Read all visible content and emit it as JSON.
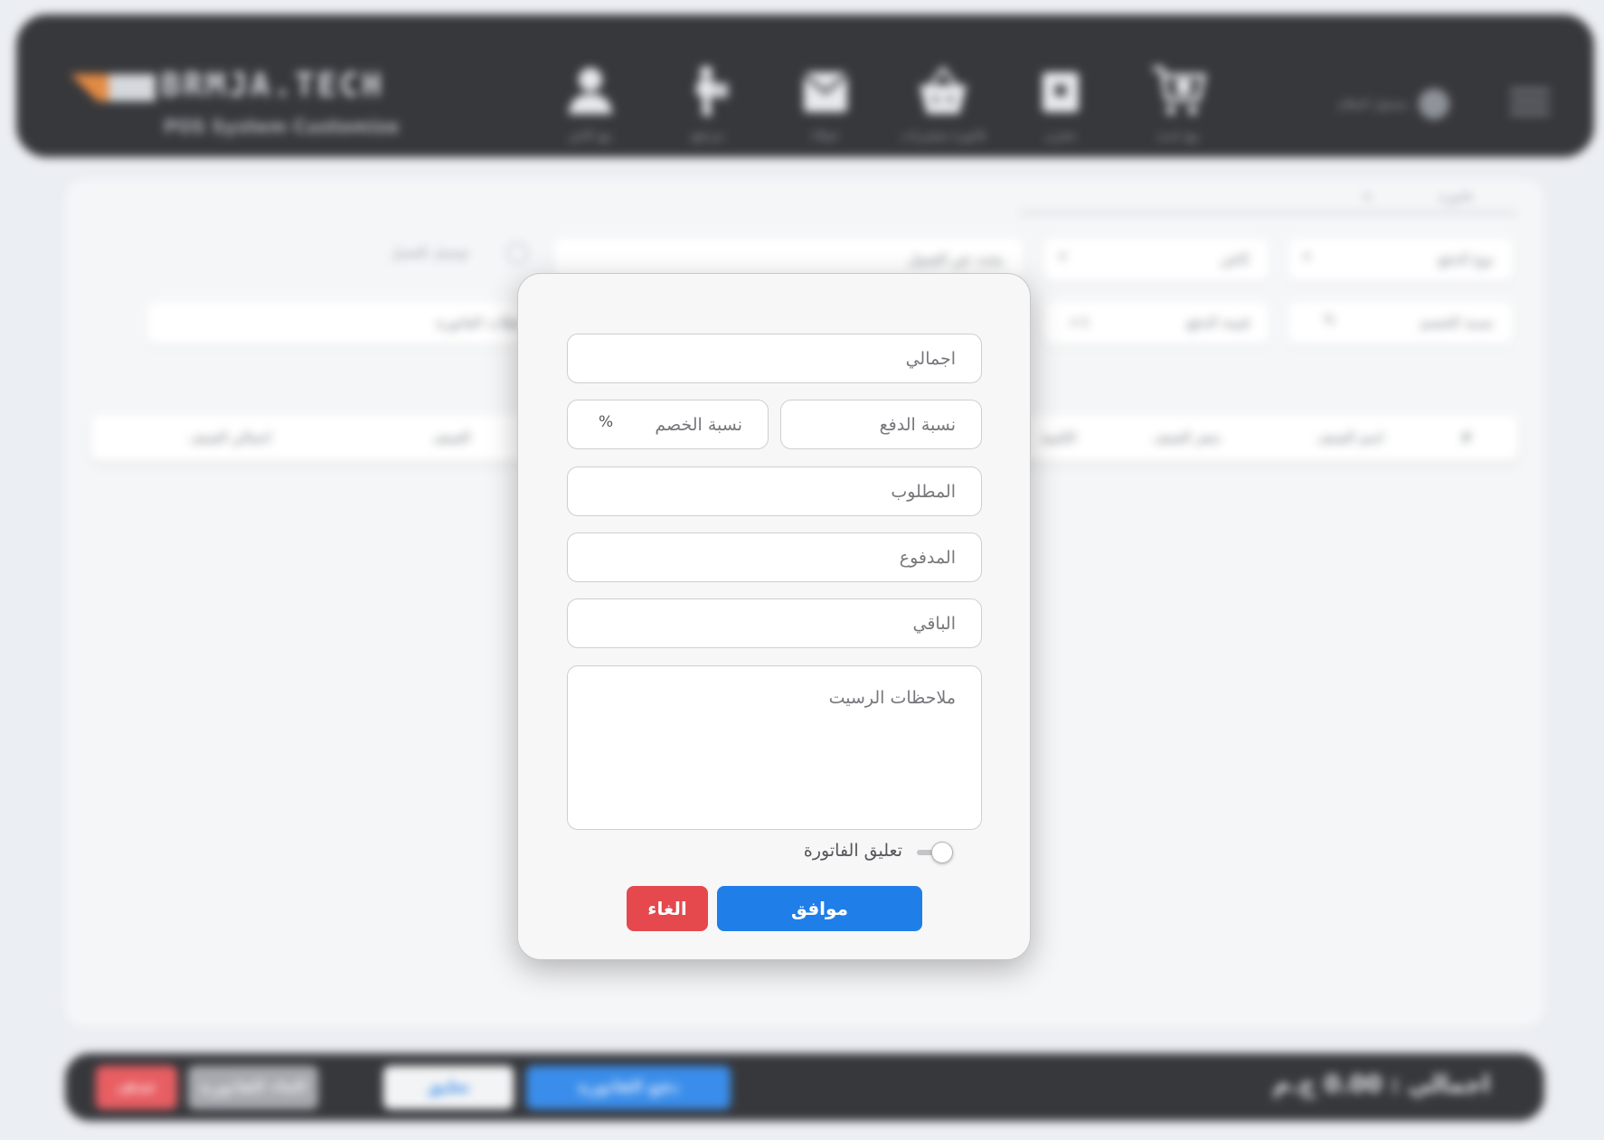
{
  "header": {
    "brand_name": "BRMJA.TECH",
    "brand_tagline": "POS System Customize",
    "nav": [
      {
        "label": "بيع جديد",
        "icon": "cart-add-icon"
      },
      {
        "label": "مخزن",
        "icon": "box-icon"
      },
      {
        "label": "فاتورة مشتريات",
        "icon": "basket-icon"
      },
      {
        "label": "عملاء",
        "icon": "mail-icon"
      },
      {
        "label": "مرتجع",
        "icon": "delivery-icon"
      },
      {
        "label": "بيع كاش",
        "icon": "user-icon"
      }
    ],
    "user_label": "مسئول النظام"
  },
  "background": {
    "breadcrumb": "فاتورة",
    "fields": {
      "sale_type": "نوع الدفع",
      "status": "كاش",
      "client_search": "بحث عن العميل",
      "delivery_label": "توصيل للعميل",
      "discount": "نسبة الخصم",
      "payment": "قيمة الدفع",
      "currency": "ج.م",
      "invoice_notes": "ملاحظات الفاتورة",
      "discount_symbol": "%"
    },
    "table_headers": [
      "#",
      "اسم الصنف",
      "سعر الصنف",
      "الكمية",
      "الصنف",
      "اجمالي الصنف"
    ],
    "footer": {
      "total": "اجمالي : 0.00 ج.م",
      "pay_button": "دفع الفاتورة",
      "hold_button": "تعليق",
      "cancel_invoice": "الغاء الفاتورة",
      "delete_button": "حذف"
    }
  },
  "modal": {
    "total_placeholder": "اجمالي",
    "payment_rate_placeholder": "نسبة الدفع",
    "discount_rate_placeholder": "نسبة الخصم",
    "percent_symbol": "%",
    "required_placeholder": "المطلوب",
    "paid_placeholder": "المدفوع",
    "remaining_placeholder": "الباقي",
    "notes_placeholder": "ملاحظات الرسيت",
    "hold_invoice_label": "تعليق الفاتورة",
    "hold_invoice_enabled": false,
    "ok_button": "موافق",
    "cancel_button": "الغاء"
  },
  "colors": {
    "header_bg": "#1c1d22",
    "primary": "#1f7ee8",
    "danger": "#e5484d",
    "modal_bg": "#f7f7f7"
  }
}
